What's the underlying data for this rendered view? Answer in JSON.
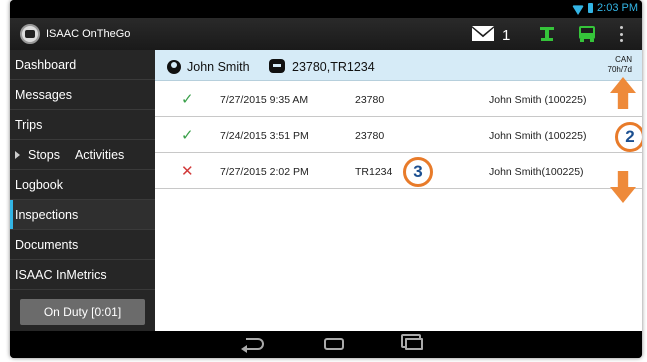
{
  "statusbar": {
    "time": "2:03 PM"
  },
  "appbar": {
    "title": "ISAAC OnTheGo",
    "message_count": "1"
  },
  "sidebar": {
    "items": [
      {
        "label": "Dashboard"
      },
      {
        "label": "Messages"
      },
      {
        "label": "Trips"
      },
      {
        "label": "Stops",
        "label2": "Activities"
      },
      {
        "label": "Logbook"
      },
      {
        "label": "Inspections",
        "active": true
      },
      {
        "label": "Documents"
      },
      {
        "label": "ISAAC InMetrics"
      }
    ],
    "duty_button": "On Duty [0:01]"
  },
  "header": {
    "driver": "John Smith",
    "vehicle": "23780,TR1234",
    "can_line1": "CAN",
    "can_line2": "70h/7d"
  },
  "inspections": [
    {
      "status": "ok",
      "date": "7/27/2015 9:35 AM",
      "unit": "23780",
      "driver": "John Smith (100225)"
    },
    {
      "status": "ok",
      "date": "7/24/2015 3:51 PM",
      "unit": "23780",
      "driver": "John Smith (100225)"
    },
    {
      "status": "bad",
      "date": "7/27/2015 2:02 PM",
      "unit": "TR1234",
      "driver": "John Smith(100225)"
    }
  ],
  "callouts": {
    "c2": "2",
    "c3": "3"
  },
  "colors": {
    "accent": "#33b5e5",
    "callout_border": "#e87b2a",
    "header_bg": "#d6ebf7"
  },
  "icons": {
    "status_ok": "✓",
    "status_bad": "✕"
  }
}
